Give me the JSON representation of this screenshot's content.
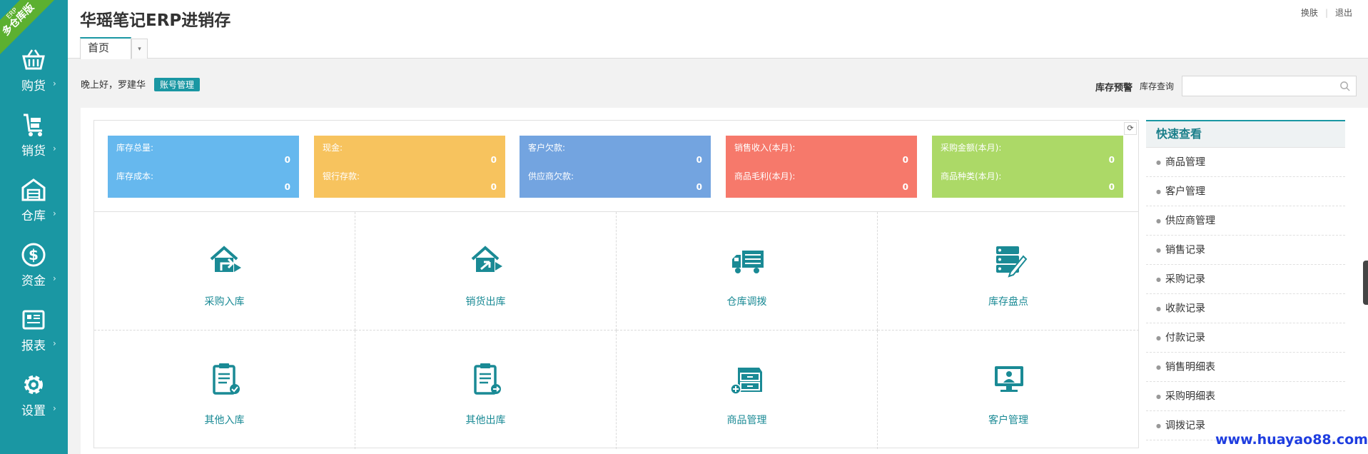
{
  "app": {
    "title": "华瑶笔记ERP进销存",
    "ribbon_top": "ERP",
    "ribbon_main": "多仓库版",
    "top_links": [
      "换肤",
      "退出"
    ]
  },
  "sidebar": {
    "items": [
      {
        "label": "购货",
        "icon": "basket-icon"
      },
      {
        "label": "销货",
        "icon": "cart-icon"
      },
      {
        "label": "仓库",
        "icon": "warehouse-icon"
      },
      {
        "label": "资金",
        "icon": "dollar-icon"
      },
      {
        "label": "报表",
        "icon": "report-icon"
      },
      {
        "label": "设置",
        "icon": "gear-icon"
      }
    ],
    "arrow": "›"
  },
  "tabs": {
    "home": "首页",
    "dropdown": "▾"
  },
  "greeting": {
    "text": "晚上好，罗建华",
    "account_button": "账号管理"
  },
  "inventory": {
    "warn_link": "库存预警",
    "query_label": "库存查询",
    "search_value": ""
  },
  "cards": [
    {
      "color": "#66b8ee",
      "l1": "库存总量:",
      "v1": "0",
      "l2": "库存成本:",
      "v2": "0"
    },
    {
      "color": "#f7c35e",
      "l1": "现金:",
      "v1": "0",
      "l2": "银行存款:",
      "v2": "0"
    },
    {
      "color": "#73a4e0",
      "l1": "客户欠款:",
      "v1": "0",
      "l2": "供应商欠款:",
      "v2": "0"
    },
    {
      "color": "#f6796b",
      "l1": "销售收入(本月):",
      "v1": "0",
      "l2": "商品毛利(本月):",
      "v2": "0"
    },
    {
      "color": "#acd967",
      "l1": "采购金额(本月):",
      "v1": "0",
      "l2": "商品种类(本月):",
      "v2": "0"
    }
  ],
  "shortcuts": [
    {
      "label": "采购入库",
      "icon": "purchase-in-icon"
    },
    {
      "label": "销货出库",
      "icon": "sales-out-icon"
    },
    {
      "label": "仓库调拨",
      "icon": "truck-icon"
    },
    {
      "label": "库存盘点",
      "icon": "stock-check-icon"
    },
    {
      "label": "其他入库",
      "icon": "clipboard-in-icon"
    },
    {
      "label": "其他出库",
      "icon": "clipboard-out-icon"
    },
    {
      "label": "商品管理",
      "icon": "goods-drawer-icon"
    },
    {
      "label": "客户管理",
      "icon": "customer-monitor-icon"
    }
  ],
  "quick_view": {
    "title": "快速查看",
    "items": [
      "商品管理",
      "客户管理",
      "供应商管理",
      "销售记录",
      "采购记录",
      "收款记录",
      "付款记录",
      "销售明细表",
      "采购明细表",
      "调拨记录"
    ]
  },
  "watermark": "www.huayao88.com",
  "colors": {
    "accent": "#1a97a3",
    "ribbon": "#5cb030",
    "watermark": "#1e3de0"
  }
}
